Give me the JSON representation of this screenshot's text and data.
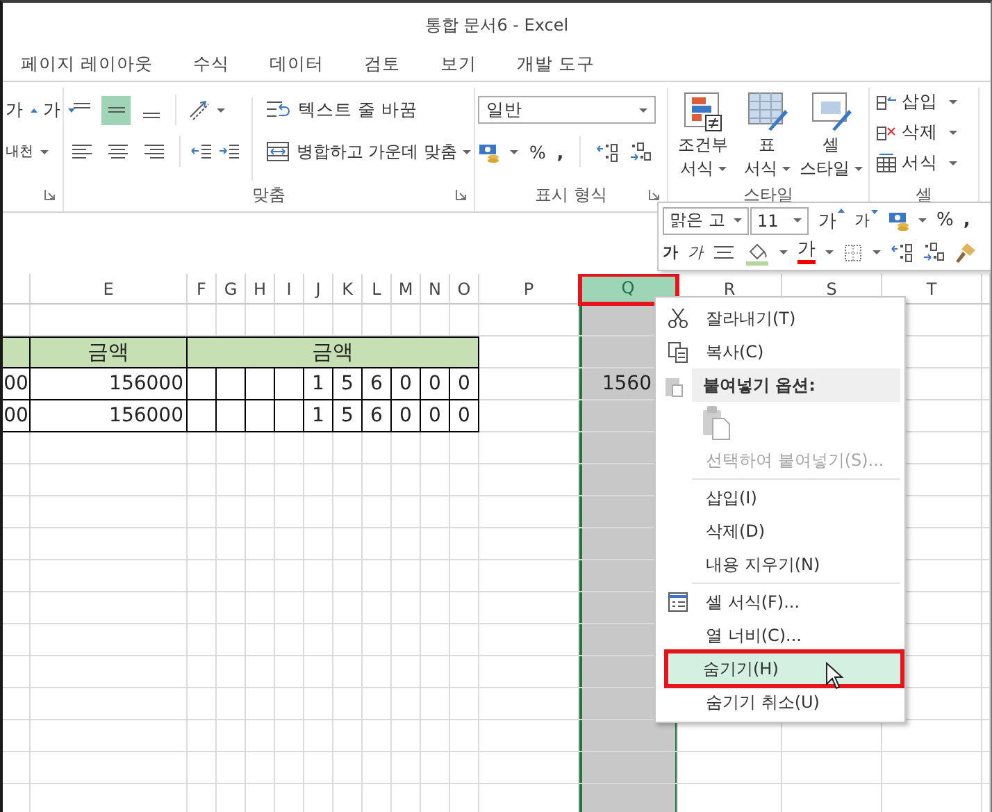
{
  "window": {
    "title": "통합 문서6 - Excel"
  },
  "tabs": [
    {
      "label": "페이지 레이아웃"
    },
    {
      "label": "수식"
    },
    {
      "label": "데이터"
    },
    {
      "label": "검토"
    },
    {
      "label": "보기"
    },
    {
      "label": "개발 도구"
    }
  ],
  "ribbon": {
    "font_group": {
      "grow": "가",
      "shrink": "가",
      "phonetic": "내천"
    },
    "alignment": {
      "label": "맞춤",
      "vertical": [
        {
          "selected": false
        },
        {
          "selected": true
        },
        {
          "selected": false
        }
      ],
      "wrap_text": "텍스트 줄 바꿈",
      "merge_center": "병합하고 가운데 맞춤"
    },
    "number": {
      "label": "표시 형식",
      "format": "일반",
      "percent": "%",
      "comma": ","
    },
    "styles": {
      "label": "스타일",
      "buttons": [
        {
          "kind": "conditional",
          "lines": [
            "조건부",
            "서식"
          ]
        },
        {
          "kind": "table",
          "lines": [
            "표",
            "서식"
          ]
        },
        {
          "kind": "cell",
          "lines": [
            "셀",
            "스타일"
          ]
        }
      ]
    },
    "cells": {
      "label": "셀",
      "buttons": [
        {
          "kind": "insert",
          "label": "삽입"
        },
        {
          "kind": "delete",
          "label": "삭제"
        },
        {
          "kind": "format",
          "label": "서식"
        }
      ]
    }
  },
  "sheet": {
    "columns": [
      {
        "in_table": true,
        "selected": false
      },
      {
        "label": "E",
        "in_table": true,
        "selected": false
      },
      {
        "label": "F",
        "in_table": true,
        "selected": false
      },
      {
        "label": "G",
        "in_table": true,
        "selected": false
      },
      {
        "label": "H",
        "in_table": true,
        "selected": false
      },
      {
        "label": "I",
        "in_table": true,
        "selected": false
      },
      {
        "label": "J",
        "in_table": true,
        "selected": false
      },
      {
        "label": "K",
        "in_table": true,
        "selected": false
      },
      {
        "label": "L",
        "in_table": true,
        "selected": false
      },
      {
        "label": "M",
        "in_table": true,
        "selected": false
      },
      {
        "label": "N",
        "in_table": true,
        "selected": false
      },
      {
        "label": "O",
        "in_table": true,
        "selected": false
      },
      {
        "label": "P",
        "in_table": false,
        "selected": false
      },
      {
        "label": "Q",
        "in_table": false,
        "selected": true,
        "annotated": true
      },
      {
        "label": "R",
        "in_table": false,
        "selected": false
      },
      {
        "label": "S",
        "in_table": false,
        "selected": false
      },
      {
        "label": "T",
        "in_table": false,
        "selected": false
      }
    ],
    "rows": [
      {
        "kind": "plain"
      },
      {
        "kind": "header",
        "cells": [
          {
            "kind": "empty"
          },
          {
            "kind": "text",
            "text": "금액"
          },
          {
            "kind": "merged",
            "text": "금액"
          }
        ]
      },
      {
        "kind": "data",
        "cells": [
          {
            "kind": "text",
            "text": "00"
          },
          {
            "kind": "text",
            "text": "156000"
          },
          {
            "kind": "empty"
          },
          {
            "kind": "empty"
          },
          {
            "kind": "empty"
          },
          {
            "kind": "empty"
          },
          {
            "kind": "text",
            "text": "1"
          },
          {
            "kind": "text",
            "text": "5"
          },
          {
            "kind": "text",
            "text": "6"
          },
          {
            "kind": "text",
            "text": "0"
          },
          {
            "kind": "text",
            "text": "0"
          },
          {
            "kind": "text",
            "text": "0"
          },
          {
            "kind": "empty"
          },
          {
            "kind": "text",
            "text": "1560"
          }
        ]
      },
      {
        "kind": "data",
        "cells": [
          {
            "kind": "text",
            "text": "00"
          },
          {
            "kind": "text",
            "text": "156000"
          },
          {
            "kind": "empty"
          },
          {
            "kind": "empty"
          },
          {
            "kind": "empty"
          },
          {
            "kind": "empty"
          },
          {
            "kind": "text",
            "text": "1"
          },
          {
            "kind": "text",
            "text": "5"
          },
          {
            "kind": "text",
            "text": "6"
          },
          {
            "kind": "text",
            "text": "0"
          },
          {
            "kind": "text",
            "text": "0"
          },
          {
            "kind": "text",
            "text": "0"
          }
        ]
      }
    ]
  },
  "mini_toolbar": {
    "font": "맑은 고",
    "size": "11",
    "grow": "가",
    "shrink": "가",
    "percent": "%",
    "comma": ",",
    "bold": "가",
    "italic": "가",
    "font_color": "가"
  },
  "context_menu": {
    "items": [
      {
        "kind": "cut",
        "label": "잘라내기(T)",
        "disabled": false,
        "highlighted": false,
        "annotated": false
      },
      {
        "kind": "copy",
        "label": "복사(C)",
        "disabled": false,
        "highlighted": false,
        "annotated": false
      },
      {
        "kind": "paste-header",
        "label": "붙여넣기 옵션:"
      },
      {
        "kind": "paste-options"
      },
      {
        "kind": "item",
        "label": "선택하여 붙여넣기(S)...",
        "disabled": true,
        "highlighted": false,
        "annotated": false
      },
      {
        "kind": "separator"
      },
      {
        "kind": "item",
        "label": "삽입(I)",
        "disabled": false,
        "highlighted": false,
        "annotated": false
      },
      {
        "kind": "item",
        "label": "삭제(D)",
        "disabled": false,
        "highlighted": false,
        "annotated": false
      },
      {
        "kind": "item",
        "label": "내용 지우기(N)",
        "disabled": false,
        "highlighted": false,
        "annotated": false
      },
      {
        "kind": "separator"
      },
      {
        "kind": "format",
        "label": "셀 서식(F)...",
        "disabled": false,
        "highlighted": false,
        "annotated": false
      },
      {
        "kind": "item",
        "label": "열 너비(C)...",
        "disabled": false,
        "highlighted": false,
        "annotated": false
      },
      {
        "kind": "item",
        "label": "숨기기(H)",
        "disabled": false,
        "highlighted": true,
        "annotated": true
      },
      {
        "kind": "item",
        "label": "숨기기 취소(U)",
        "disabled": false,
        "highlighted": false,
        "annotated": false
      }
    ]
  }
}
